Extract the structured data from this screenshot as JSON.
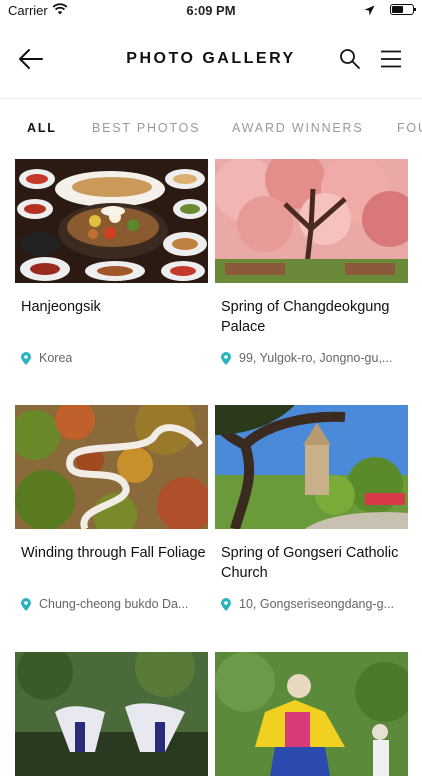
{
  "status": {
    "carrier": "Carrier",
    "time": "6:09 PM"
  },
  "header": {
    "title": "PHOTO GALLERY"
  },
  "tabs": [
    {
      "label": "ALL",
      "active": true
    },
    {
      "label": "BEST PHOTOS",
      "active": false
    },
    {
      "label": "AWARD WINNERS",
      "active": false
    },
    {
      "label": "FOU",
      "active": false
    }
  ],
  "cards": [
    {
      "title": "Hanjeongsik",
      "location": "Korea",
      "image": "korean-food-icon"
    },
    {
      "title": " Spring of Changdeokgung Palace",
      "location": "99, Yulgok-ro, Jongno-gu,...",
      "image": "pink-tree-icon"
    },
    {
      "title": "Winding through Fall Foliage",
      "location": "Chung-cheong bukdo  Da...",
      "image": "winding-road-icon"
    },
    {
      "title": "Spring of Gongseri Catholic Church",
      "location": "10, Gongseriseongdang-g...",
      "image": "church-tree-icon"
    },
    {
      "title": "",
      "location": "",
      "image": "dancers-icon"
    },
    {
      "title": "",
      "location": "",
      "image": "mask-dancer-icon"
    }
  ],
  "colors": {
    "accent": "#2bb3c0",
    "text": "#111111",
    "muted": "#9a9a9a"
  }
}
